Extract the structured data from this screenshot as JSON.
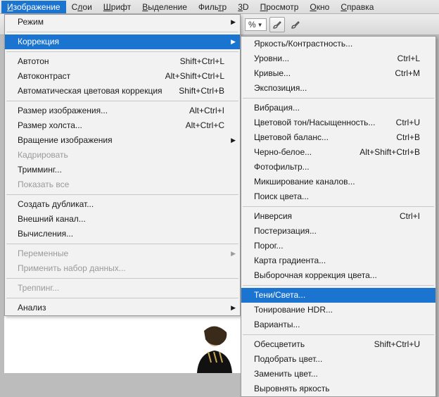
{
  "menubar": {
    "items": [
      {
        "pre": "",
        "ul": "И",
        "post": "зображение",
        "active": true
      },
      {
        "pre": "С",
        "ul": "л",
        "post": "ои"
      },
      {
        "pre": "",
        "ul": "Ш",
        "post": "рифт"
      },
      {
        "pre": "",
        "ul": "В",
        "post": "ыделение"
      },
      {
        "pre": "Филь",
        "ul": "т",
        "post": "р"
      },
      {
        "pre": "",
        "ul": "3",
        "post": "D"
      },
      {
        "pre": "",
        "ul": "П",
        "post": "росмотр"
      },
      {
        "pre": "",
        "ul": "О",
        "post": "кно"
      },
      {
        "pre": "",
        "ul": "С",
        "post": "правка"
      }
    ]
  },
  "toolbar": {
    "pct": "%"
  },
  "menu1": {
    "groups": [
      [
        {
          "label": "Режим",
          "arrow": true
        }
      ],
      [
        {
          "label": "Коррекция",
          "arrow": true,
          "hl": true
        }
      ],
      [
        {
          "label": "Автотон",
          "sc": "Shift+Ctrl+L"
        },
        {
          "label": "Автоконтраст",
          "sc": "Alt+Shift+Ctrl+L"
        },
        {
          "label": "Автоматическая цветовая коррекция",
          "sc": "Shift+Ctrl+B"
        }
      ],
      [
        {
          "label": "Размер изображения...",
          "sc": "Alt+Ctrl+I"
        },
        {
          "label": "Размер холста...",
          "sc": "Alt+Ctrl+C"
        },
        {
          "label": "Вращение изображения",
          "arrow": true
        },
        {
          "label": "Кадрировать",
          "disabled": true
        },
        {
          "label": "Тримминг..."
        },
        {
          "label": "Показать все",
          "disabled": true
        }
      ],
      [
        {
          "label": "Создать дубликат..."
        },
        {
          "label": "Внешний канал..."
        },
        {
          "label": "Вычисления..."
        }
      ],
      [
        {
          "label": "Переменные",
          "arrow": true,
          "disabled": true
        },
        {
          "label": "Применить набор данных...",
          "disabled": true
        }
      ],
      [
        {
          "label": "Треппинг...",
          "disabled": true
        }
      ],
      [
        {
          "label": "Анализ",
          "arrow": true
        }
      ]
    ]
  },
  "menu2": {
    "groups": [
      [
        {
          "label": "Яркость/Контрастность..."
        },
        {
          "label": "Уровни...",
          "sc": "Ctrl+L"
        },
        {
          "label": "Кривые...",
          "sc": "Ctrl+M"
        },
        {
          "label": "Экспозиция..."
        }
      ],
      [
        {
          "label": "Вибрация..."
        },
        {
          "label": "Цветовой тон/Насыщенность...",
          "sc": "Ctrl+U"
        },
        {
          "label": "Цветовой баланс...",
          "sc": "Ctrl+B"
        },
        {
          "label": "Черно-белое...",
          "sc": "Alt+Shift+Ctrl+B"
        },
        {
          "label": "Фотофильтр..."
        },
        {
          "label": "Микширование каналов..."
        },
        {
          "label": "Поиск цвета..."
        }
      ],
      [
        {
          "label": "Инверсия",
          "sc": "Ctrl+I"
        },
        {
          "label": "Постеризация..."
        },
        {
          "label": "Порог..."
        },
        {
          "label": "Карта градиента..."
        },
        {
          "label": "Выборочная коррекция цвета..."
        }
      ],
      [
        {
          "label": "Тени/Света...",
          "hl": true
        },
        {
          "label": "Тонирование HDR..."
        },
        {
          "label": "Варианты..."
        }
      ],
      [
        {
          "label": "Обесцветить",
          "sc": "Shift+Ctrl+U"
        },
        {
          "label": "Подобрать цвет..."
        },
        {
          "label": "Заменить цвет..."
        },
        {
          "label": "Выровнять яркость"
        }
      ]
    ]
  }
}
